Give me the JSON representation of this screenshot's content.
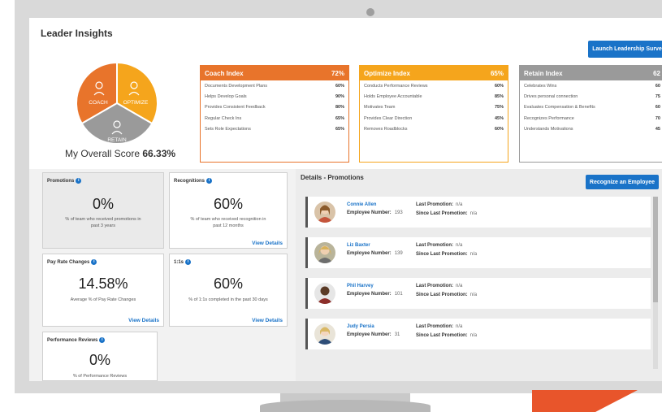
{
  "page": {
    "title": "Leader Insights",
    "launch_button": "Launch Leadership Survey"
  },
  "pie": {
    "coach": "COACH",
    "optimize": "OPTIMIZE",
    "retain": "RETAIN"
  },
  "score": {
    "label": "My Overall Score",
    "value": "66.33%"
  },
  "indices": {
    "coach": {
      "title": "Coach Index",
      "value": "72%",
      "rows": [
        {
          "label": "Documents Development Plans",
          "value": "60%"
        },
        {
          "label": "Helps Develop Goals",
          "value": "90%"
        },
        {
          "label": "Provides Consistent Feedback",
          "value": "80%"
        },
        {
          "label": "Regular Check Ins",
          "value": "65%"
        },
        {
          "label": "Sets Role Expectations",
          "value": "65%"
        }
      ]
    },
    "optimize": {
      "title": "Optimize Index",
      "value": "65%",
      "rows": [
        {
          "label": "Conducts Performance Reviews",
          "value": "60%"
        },
        {
          "label": "Holds Employee Accountable",
          "value": "85%"
        },
        {
          "label": "Motivates Team",
          "value": "75%"
        },
        {
          "label": "Provides Clear Direction",
          "value": "45%"
        },
        {
          "label": "Removes Roadblocks",
          "value": "60%"
        }
      ]
    },
    "retain": {
      "title": "Retain Index",
      "value": "62",
      "rows": [
        {
          "label": "Celebrates Wins",
          "value": "60"
        },
        {
          "label": "Drives personal connection",
          "value": "75"
        },
        {
          "label": "Evaluates Compensation & Benefits",
          "value": "60"
        },
        {
          "label": "Recognizes Performance",
          "value": "70"
        },
        {
          "label": "Understands Motivations",
          "value": "45"
        }
      ]
    }
  },
  "metrics": {
    "promotions": {
      "title": "Promotions",
      "value": "0%",
      "desc": "% of team who received promotions in past 3 years"
    },
    "recognitions": {
      "title": "Recognitions",
      "value": "60%",
      "desc": "% of team who received recognition in past 12 months",
      "link": "View Details"
    },
    "pay": {
      "title": "Pay Rate Changes",
      "value": "14.58%",
      "desc": "Average % of Pay Rate Changes",
      "link": "View Details"
    },
    "oneone": {
      "title": "1:1s",
      "value": "60%",
      "desc": "% of 1:1s completed in the past 30 days",
      "link": "View Details"
    },
    "reviews": {
      "title": "Performance Reviews",
      "value": "0%",
      "desc": "% of Performance Reviews"
    }
  },
  "details": {
    "title": "Details - Promotions",
    "recognize_button": "Recognize an Employee",
    "labels": {
      "employee_number": "Employee Number:",
      "last_promotion": "Last Promotion:",
      "since_last_promotion": "Since Last Promotion:"
    },
    "employees": [
      {
        "name": "Connie Allen",
        "number": "193",
        "last_promotion": "n/a",
        "since": "n/a"
      },
      {
        "name": "Liz Baxter",
        "number": "139",
        "last_promotion": "n/a",
        "since": "n/a"
      },
      {
        "name": "Phil Harvey",
        "number": "101",
        "last_promotion": "n/a",
        "since": "n/a"
      },
      {
        "name": "Judy Persia",
        "number": "31",
        "last_promotion": "n/a",
        "since": "n/a"
      }
    ]
  },
  "colors": {
    "coach": "#e8742b",
    "optimize": "#f5a51c",
    "retain": "#9a9a9a",
    "accent": "#1a73c8"
  }
}
